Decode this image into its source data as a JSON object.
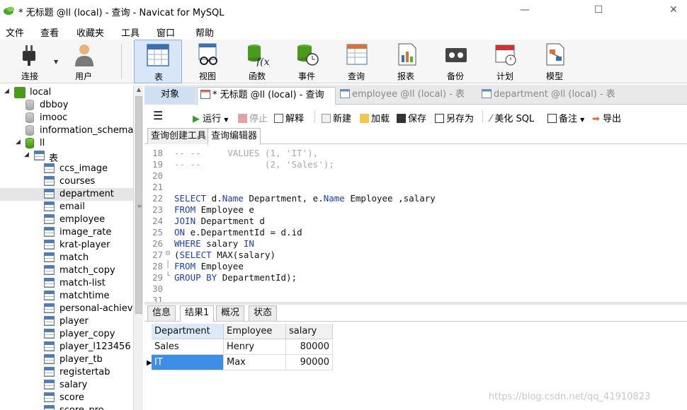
{
  "window": {
    "title": "* 无标题 @ll (local) - 查询 - Navicat for MySQL",
    "min_glyph": "—",
    "max_glyph": "☐",
    "close_glyph": "✕"
  },
  "menu": [
    "文件",
    "查看",
    "收藏夹",
    "工具",
    "窗口",
    "帮助"
  ],
  "toolbar": {
    "connect": "连接",
    "user": "用户",
    "table": "表",
    "view": "视图",
    "function": "函数",
    "event": "事件",
    "query": "查询",
    "report": "报表",
    "backup": "备份",
    "schedule": "计划",
    "model": "模型"
  },
  "tree": {
    "connection": "local",
    "databases": [
      "dbboy",
      "imooc",
      "information_schema",
      "ll"
    ],
    "tables_folder": "表",
    "tables": [
      "ccs_image",
      "courses",
      "department",
      "email",
      "employee",
      "image_rate",
      "krat-player",
      "match",
      "match_copy",
      "match-list",
      "matchtime",
      "personal-achiever",
      "player",
      "player_copy",
      "player_l123456",
      "player_tb",
      "registertab",
      "salary",
      "score",
      "score_pro"
    ],
    "selected_table": "department"
  },
  "tabs": {
    "objects": "对象",
    "query1": "* 无标题 @ll (local) - 查询",
    "employee": "employee @ll (local) - 表",
    "department": "department @ll (local) - 表"
  },
  "editor_toolbar": {
    "run": "运行",
    "stop": "停止",
    "explain": "解释",
    "new": "新建",
    "load": "加载",
    "save": "保存",
    "save_as": "另存为",
    "beautify": "美化 SQL",
    "comment": "备注",
    "export": "导出"
  },
  "subtabs": {
    "builder": "查询创建工具",
    "editor": "查询编辑器"
  },
  "code_lines": [
    {
      "n": "18",
      "fold": "",
      "parts": [
        {
          "t": "-- --     VALUES (1, 'IT'),",
          "c": "cm"
        }
      ]
    },
    {
      "n": "19",
      "fold": "",
      "parts": [
        {
          "t": "-- --            (2, 'Sales');",
          "c": "cm"
        }
      ]
    },
    {
      "n": "20",
      "fold": "",
      "parts": []
    },
    {
      "n": "21",
      "fold": "",
      "parts": []
    },
    {
      "n": "22",
      "fold": "",
      "parts": [
        {
          "t": "SELECT",
          "c": "kw"
        },
        {
          "t": " d.",
          "c": ""
        },
        {
          "t": "Name",
          "c": "fd"
        },
        {
          "t": " Department, e.",
          "c": ""
        },
        {
          "t": "Name",
          "c": "fd"
        },
        {
          "t": " Employee ,salary",
          "c": ""
        }
      ]
    },
    {
      "n": "23",
      "fold": "",
      "parts": [
        {
          "t": "FROM",
          "c": "kw"
        },
        {
          "t": " Employee e",
          "c": ""
        }
      ]
    },
    {
      "n": "24",
      "fold": "",
      "parts": [
        {
          "t": "JOIN",
          "c": "kw"
        },
        {
          "t": " Department d",
          "c": ""
        }
      ]
    },
    {
      "n": "25",
      "fold": "",
      "parts": [
        {
          "t": "ON",
          "c": "kw"
        },
        {
          "t": " e.DepartmentId = d.id",
          "c": ""
        }
      ]
    },
    {
      "n": "26",
      "fold": "",
      "parts": [
        {
          "t": "WHERE",
          "c": "kw"
        },
        {
          "t": " salary ",
          "c": ""
        },
        {
          "t": "IN",
          "c": "kw"
        }
      ]
    },
    {
      "n": "27",
      "fold": "⊟",
      "parts": [
        {
          "t": "(",
          "c": ""
        },
        {
          "t": "SELECT",
          "c": "kw"
        },
        {
          "t": " MAX(salary)",
          "c": ""
        }
      ]
    },
    {
      "n": "28",
      "fold": "│",
      "parts": [
        {
          "t": "FROM",
          "c": "kw"
        },
        {
          "t": " Employee",
          "c": ""
        }
      ]
    },
    {
      "n": "29",
      "fold": "└",
      "parts": [
        {
          "t": "GROUP BY",
          "c": "kw"
        },
        {
          "t": " DepartmentId);",
          "c": ""
        }
      ]
    },
    {
      "n": "30",
      "fold": "",
      "parts": []
    },
    {
      "n": "31",
      "fold": "",
      "parts": []
    }
  ],
  "result_tabs": [
    "信息",
    "结果1",
    "概况",
    "状态"
  ],
  "grid": {
    "columns": [
      "Department",
      "Employee",
      "salary"
    ],
    "rows": [
      [
        "Sales",
        "Henry",
        "80000"
      ],
      [
        "IT",
        "Max",
        "90000"
      ]
    ],
    "current_row_marker": "▶"
  },
  "watermark": "https://blog.csdn.net/qq_41910823"
}
